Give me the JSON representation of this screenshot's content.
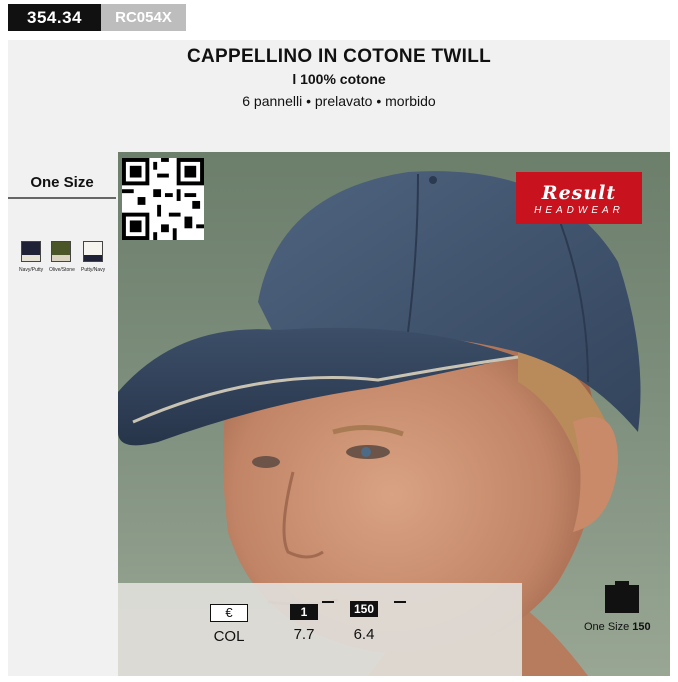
{
  "codes": {
    "main": "354.34",
    "sub": "RC054X"
  },
  "header": {
    "title": "CAPPELLINO IN COTONE TWILL",
    "subtitle": "l 100% cotone",
    "features": "6 pannelli • prelavato • morbido"
  },
  "sidebar": {
    "size": "One Size",
    "colors": [
      {
        "name": "Navy/Putty",
        "top": "#1f2236",
        "bottom": "#e6e2d6"
      },
      {
        "name": "Olive/Stone",
        "top": "#4a5528",
        "bottom": "#d9d3bf"
      },
      {
        "name": "Putty/Navy",
        "top": "#f6f4ef",
        "bottom": "#1f2236"
      }
    ]
  },
  "logo": {
    "brand": "Result",
    "line": "HEADWEAR",
    "color": "#c8121e"
  },
  "pricing": {
    "euro_symbol": "€",
    "col_label": "COL",
    "qty1_label": "1",
    "qty1_price": "7.7",
    "qty150_label": "150",
    "qty150_price": "6.4"
  },
  "pack": {
    "size": "One Size",
    "qty": "150"
  }
}
